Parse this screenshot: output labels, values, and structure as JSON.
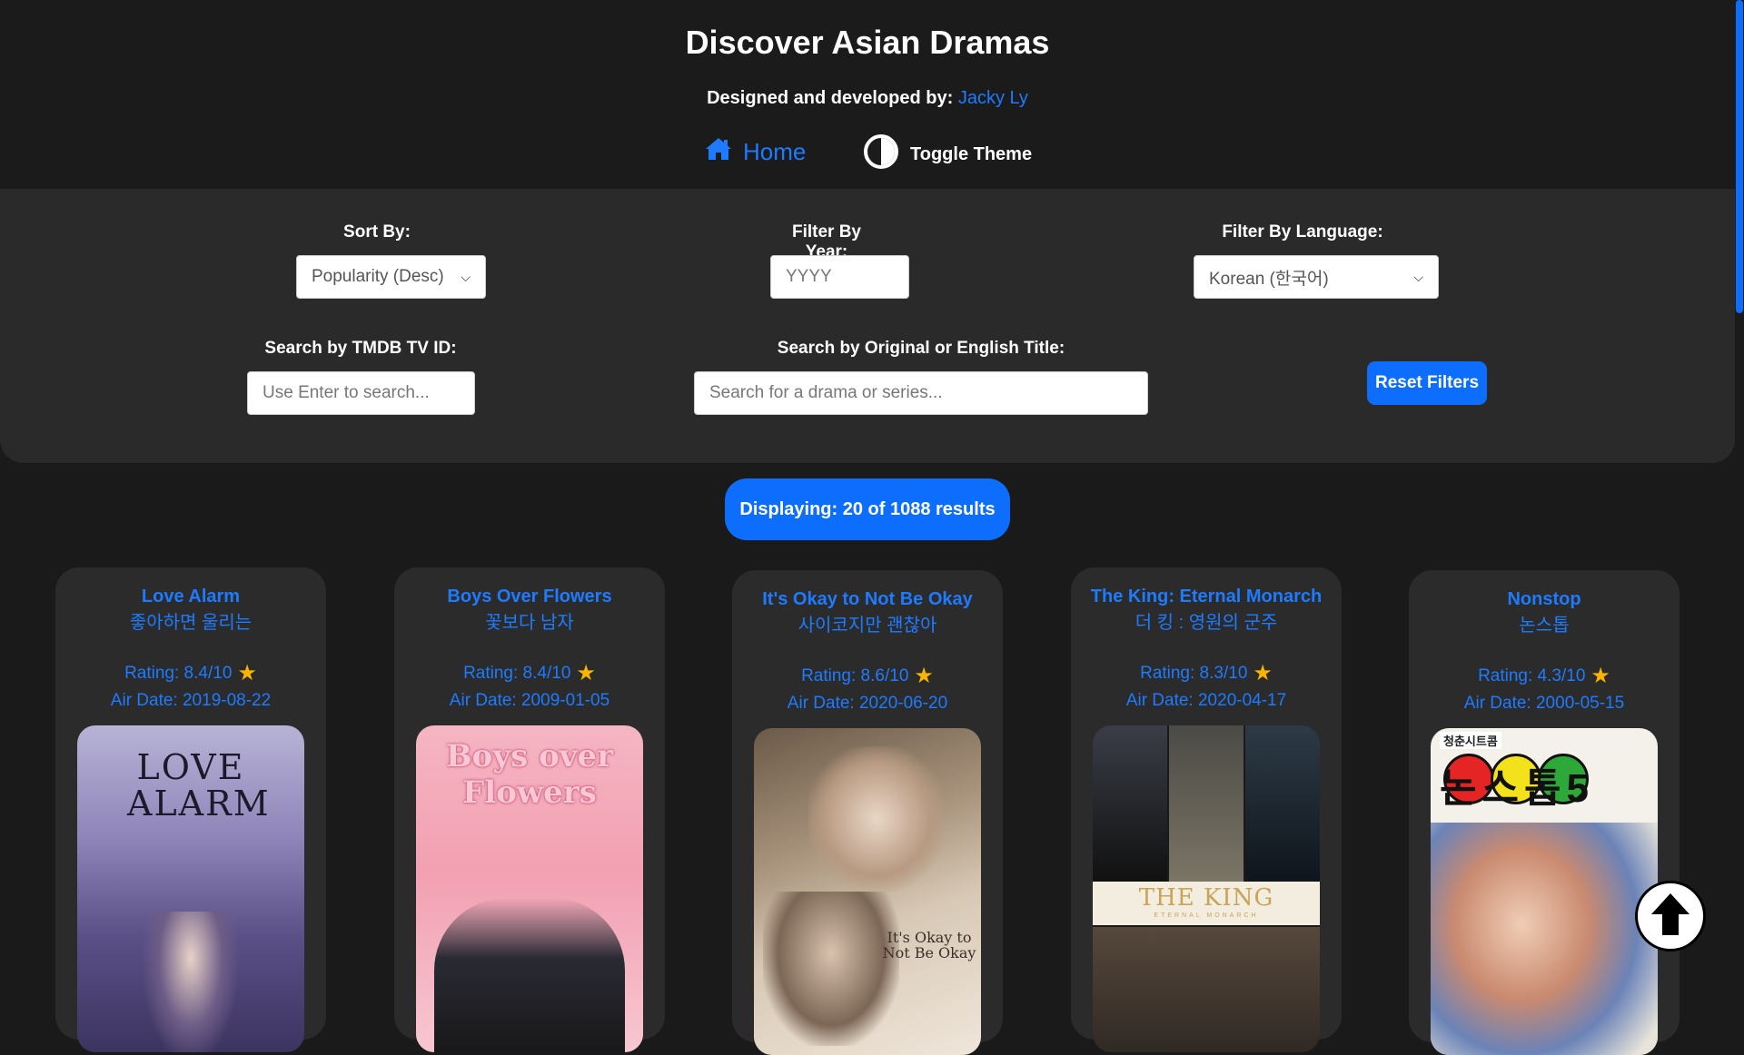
{
  "header": {
    "title": "Discover Asian Dramas",
    "credit_prefix": "Designed and developed by:",
    "credit_name": "Jacky Ly",
    "nav_home": "Home",
    "nav_theme": "Toggle Theme"
  },
  "filters": {
    "sort_label": "Sort By:",
    "sort_value": "Popularity (Desc)",
    "year_label": "Filter By Year:",
    "year_placeholder": "YYYY",
    "language_label": "Filter By Language:",
    "language_value": "Korean (한국어)",
    "tmdb_label": "Search by TMDB TV ID:",
    "tmdb_placeholder": "Use Enter to search...",
    "title_label": "Search by Original or English Title:",
    "title_placeholder": "Search for a drama or series...",
    "reset_label": "Reset Filters"
  },
  "results": {
    "text": "Displaying: 20 of 1088 results"
  },
  "cards": [
    {
      "title": "Love Alarm",
      "original": "좋아하면 울리는",
      "rating": "Rating: 8.4/10",
      "air_date": "Air Date: 2019-08-22",
      "poster_text": "LOVE ALARM"
    },
    {
      "title": "Boys Over Flowers",
      "original": "꽃보다 남자",
      "rating": "Rating: 8.4/10",
      "air_date": "Air Date: 2009-01-05",
      "poster_text": "Boys over Flowers"
    },
    {
      "title": "It's Okay to Not Be Okay",
      "original": "사이코지만 괜찮아",
      "rating": "Rating: 8.6/10",
      "air_date": "Air Date: 2020-06-20",
      "poster_text": "It's Okay to Not Be Okay"
    },
    {
      "title": "The King: Eternal Monarch",
      "original": "더 킹 : 영원의 군주",
      "rating": "Rating: 8.3/10",
      "air_date": "Air Date: 2020-04-17",
      "poster_text": "THE KING",
      "poster_subtext": "ETERNAL MONARCH"
    },
    {
      "title": "Nonstop",
      "original": "논스톱",
      "rating": "Rating: 4.3/10",
      "air_date": "Air Date: 2000-05-15",
      "poster_text": "논스톱5",
      "poster_subtext": "청춘시트콤"
    }
  ],
  "icons": {
    "home": "home-icon",
    "theme": "half-circle-icon",
    "star": "star-icon",
    "scroll_top": "arrow-up-icon"
  },
  "colors": {
    "background": "#1a1a1a",
    "panel": "#2a2a2a",
    "accent": "#1e7bff",
    "button": "#0d6efd",
    "star": "#f7b500"
  }
}
